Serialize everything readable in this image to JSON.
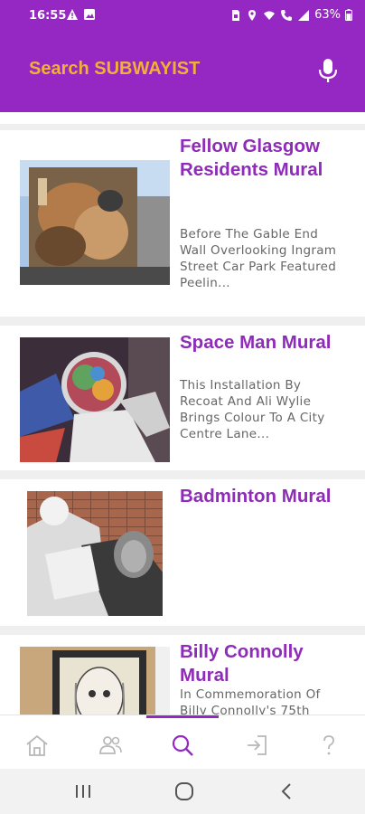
{
  "status_bar": {
    "time": "16:55",
    "battery": "63%"
  },
  "app_bar": {
    "search_title": "Search SUBWAYIST",
    "mic_icon": "mic-icon"
  },
  "results": [
    {
      "title": "Fellow Glasgow Residents Mural",
      "description": "Before The Gable End Wall Overlooking Ingram Street Car Park Featured Peelin..."
    },
    {
      "title": "Space Man Mural",
      "description": "This Installation By Recoat And Ali Wylie Brings Colour To A City Centre Lane..."
    },
    {
      "title": "Badminton Mural",
      "description": ""
    },
    {
      "title": "Billy Connolly Mural",
      "description": "In Commemoration Of Billy Connolly's 75th"
    }
  ],
  "bottom_nav": {
    "items": [
      "home-icon",
      "people-icon",
      "search-icon",
      "login-icon",
      "help-icon"
    ],
    "active": "search-icon",
    "accent": "#9527c2",
    "inactive": "#b8b8b8"
  },
  "colors": {
    "primary": "#9527c2",
    "title_accent": "#f4b036",
    "card_title": "#8e2bb8"
  },
  "system_nav": [
    "recents-icon",
    "home-circle-icon",
    "back-icon"
  ]
}
